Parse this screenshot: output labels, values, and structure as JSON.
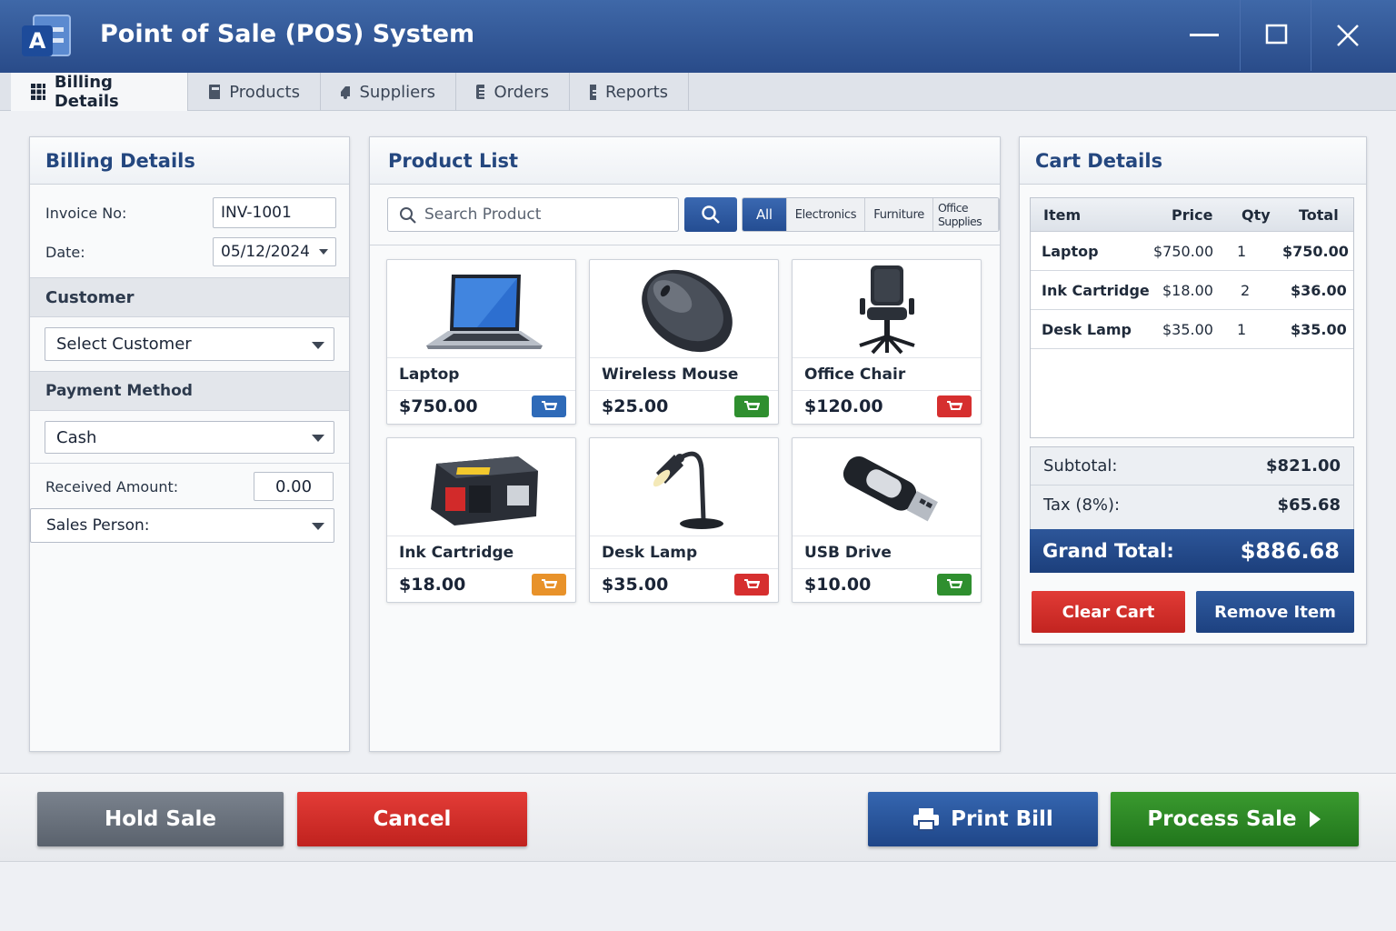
{
  "window": {
    "title": "Point of Sale (POS) System",
    "logo_letter": "A"
  },
  "tabs": [
    {
      "label": "Billing Details",
      "icon": "grid-icon",
      "active": true
    },
    {
      "label": "Products",
      "icon": "box-icon"
    },
    {
      "label": "Suppliers",
      "icon": "truck-icon"
    },
    {
      "label": "Orders",
      "icon": "list-icon"
    },
    {
      "label": "Reports",
      "icon": "document-icon"
    }
  ],
  "billing": {
    "title": "Billing Details",
    "invoice_label": "Invoice No:",
    "invoice_value": "INV-1001",
    "date_label": "Date:",
    "date_value": "05/12/2024",
    "customer_heading": "Customer",
    "customer_select": "Select Customer",
    "payment_heading": "Payment Method",
    "payment_select": "Cash",
    "received_label": "Received Amount:",
    "received_value": "0.00",
    "salesperson_label": "Sales Person:"
  },
  "products": {
    "title": "Product List",
    "search_placeholder": "Search Product",
    "filters": [
      "All",
      "Electronics",
      "Furniture",
      "Office Supplies"
    ],
    "items": [
      {
        "name": "Laptop",
        "price": "$750.00",
        "image": "laptop-image",
        "cart_color": "#2e6ab8"
      },
      {
        "name": "Wireless Mouse",
        "price": "$25.00",
        "image": "mouse-image",
        "cart_color": "#2f8f2f"
      },
      {
        "name": "Office Chair",
        "price": "$120.00",
        "image": "chair-image",
        "cart_color": "#d62f2f"
      },
      {
        "name": "Ink Cartridge",
        "price": "$18.00",
        "image": "printer-image",
        "cart_color": "#e8922a"
      },
      {
        "name": "Desk Lamp",
        "price": "$35.00",
        "image": "lamp-image",
        "cart_color": "#d62f2f"
      },
      {
        "name": "USB Drive",
        "price": "$10.00",
        "image": "usb-image",
        "cart_color": "#2f8f2f"
      }
    ]
  },
  "cart": {
    "title": "Cart Details",
    "columns": [
      "Item",
      "Price",
      "Qty",
      "Total"
    ],
    "rows": [
      {
        "item": "Laptop",
        "price": "$750.00",
        "qty": "1",
        "total": "$750.00"
      },
      {
        "item": "Ink Cartridge",
        "price": "$18.00",
        "qty": "2",
        "total": "$36.00"
      },
      {
        "item": "Desk Lamp",
        "price": "$35.00",
        "qty": "1",
        "total": "$35.00"
      }
    ],
    "subtotal_label": "Subtotal:",
    "subtotal_value": "$821.00",
    "tax_label": "Tax (8%):",
    "tax_value": "$65.68",
    "grand_label": "Grand Total:",
    "grand_value": "$886.68",
    "clear_label": "Clear Cart",
    "remove_label": "Remove Item"
  },
  "actions": {
    "hold_label": "Hold Sale",
    "cancel_label": "Cancel",
    "print_label": "Print Bill",
    "process_label": "Process Sale"
  },
  "colors": {
    "brand": "#2a4c8a",
    "danger": "#d62f2f",
    "success": "#2f8f2f",
    "neutral": "#646c78"
  }
}
